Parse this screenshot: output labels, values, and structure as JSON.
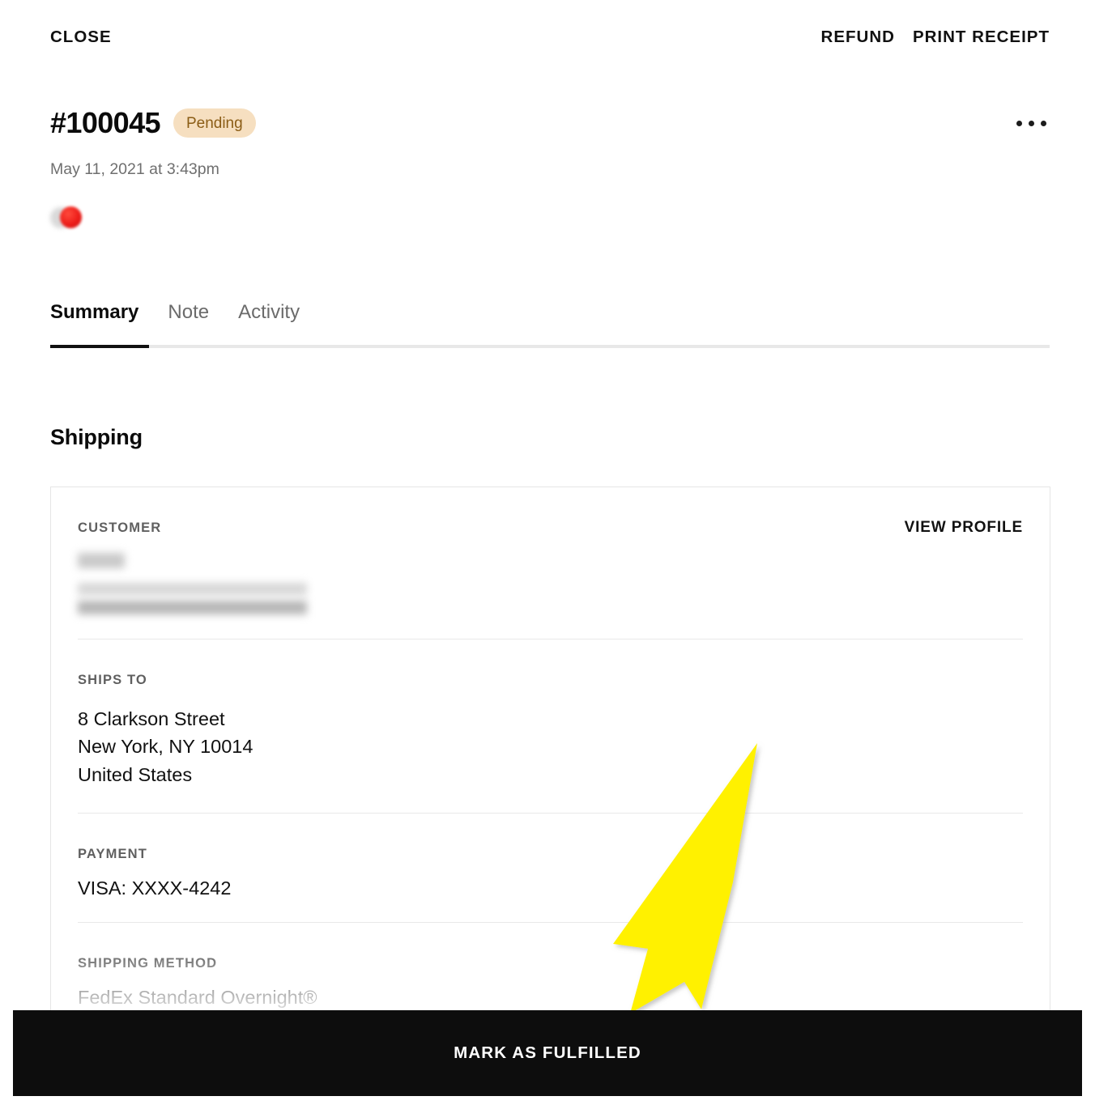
{
  "topbar": {
    "close_label": "CLOSE",
    "refund_label": "REFUND",
    "print_receipt_label": "PRINT RECEIPT"
  },
  "order": {
    "number": "#100045",
    "status": "Pending",
    "status_bg": "#F6DFC0",
    "status_color": "#8B5D16",
    "date": "May 11, 2021 at 3:43pm",
    "more_menu": "•••"
  },
  "tabs": [
    {
      "label": "Summary",
      "active": true
    },
    {
      "label": "Note",
      "active": false
    },
    {
      "label": "Activity",
      "active": false
    }
  ],
  "shipping": {
    "section_title": "Shipping",
    "customer": {
      "label": "CUSTOMER",
      "view_profile_label": "VIEW PROFILE",
      "name": "",
      "email": ""
    },
    "ships_to": {
      "label": "SHIPS TO",
      "line1": "8 Clarkson Street",
      "line2": "New York, NY 10014",
      "line3": "United States"
    },
    "payment": {
      "label": "PAYMENT",
      "value": "VISA: XXXX-4242"
    },
    "shipping_method": {
      "label": "SHIPPING METHOD",
      "value": "FedEx Standard Overnight®"
    }
  },
  "cta": {
    "label": "MARK AS FULFILLED"
  },
  "annotation": {
    "type": "arrow",
    "color": "#FFF100",
    "points_to": "mark-as-fulfilled-button"
  }
}
